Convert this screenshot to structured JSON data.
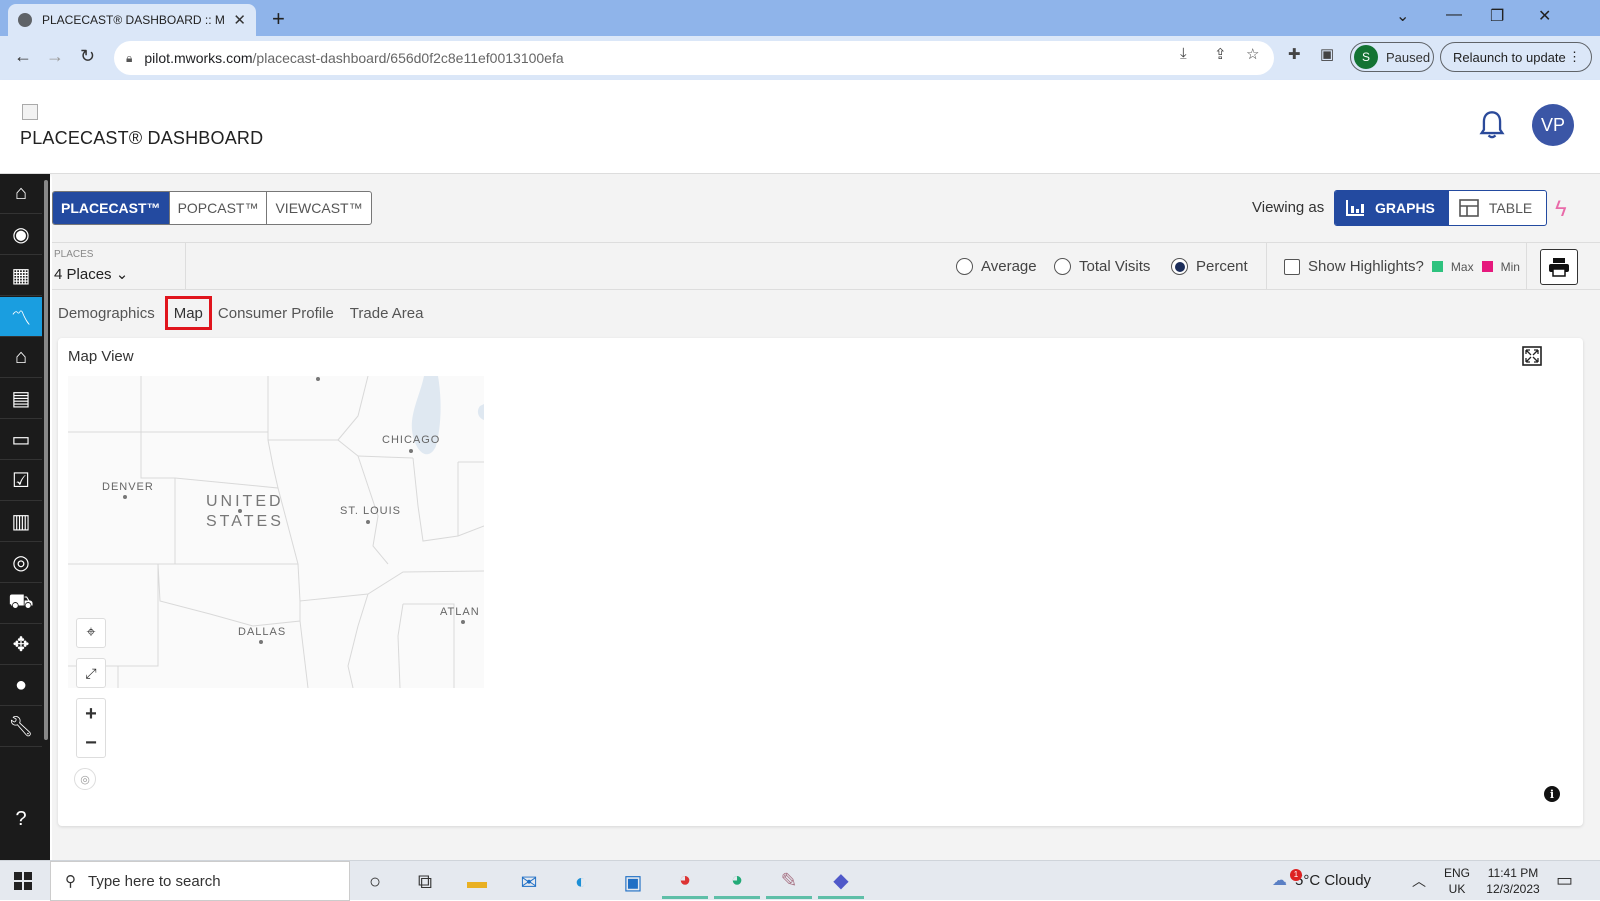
{
  "browser": {
    "tab_title": "PLACECAST® DASHBOARD :: M",
    "url_host": "pilot.mworks.com",
    "url_path": "/placecast-dashboard/656d0f2c8e11ef0013100efa",
    "profile_initial": "S",
    "profile_status": "Paused",
    "relaunch_label": "Relaunch to update"
  },
  "header": {
    "brand": "PLACECAST® DASHBOARD",
    "user_initials": "VP"
  },
  "sidebar": {
    "items": [
      "home-icon",
      "compass-icon",
      "apps-grid-icon",
      "trending-chart-icon",
      "buildings-icon",
      "report-icon",
      "store-icon",
      "checklist-icon",
      "bar-chart-icon",
      "target-icon",
      "vehicles-icon",
      "network-icon",
      "user-icon",
      "wrench-icon",
      "help-icon"
    ],
    "active_index": 3
  },
  "product_tabs": [
    "PLACECAST™",
    "POPCAST™",
    "VIEWCAST™"
  ],
  "view": {
    "viewing_as_label": "Viewing as",
    "graphs_label": "GRAPHS",
    "table_label": "TABLE"
  },
  "filters": {
    "places_label": "PLACES",
    "places_value": "4 Places",
    "radio_options": [
      "Average",
      "Total Visits",
      "Percent"
    ],
    "selected_radio": "Percent",
    "highlights_label": "Show Highlights?",
    "max_label": "Max",
    "min_label": "Min",
    "max_color": "#2ec27e",
    "min_color": "#e6197d"
  },
  "subtabs": [
    "Demographics",
    "Map",
    "Consumer Profile",
    "Trade Area"
  ],
  "active_subtab": "Map",
  "map": {
    "title": "Map View",
    "labels": {
      "chicago": "CHICAGO",
      "denver": "DENVER",
      "united": "UNITED",
      "states": "STATES",
      "st_louis": "ST. LOUIS",
      "atlanta": "ATLAN",
      "dallas": "DALLAS"
    },
    "zoom_in": "+",
    "zoom_out": "−"
  },
  "taskbar": {
    "search_placeholder": "Type here to search",
    "weather": "5°C  Cloudy",
    "weather_badge": "1",
    "lang_top": "ENG",
    "lang_bottom": "UK",
    "time": "11:41 PM",
    "date": "12/3/2023"
  }
}
